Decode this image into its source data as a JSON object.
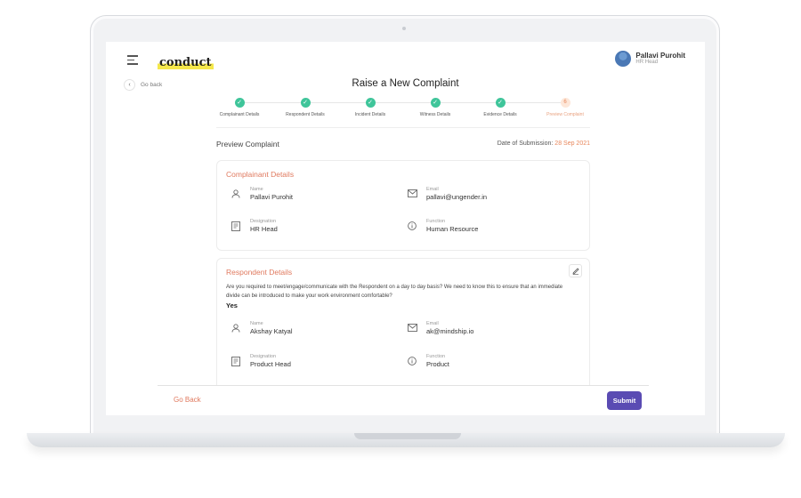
{
  "header": {
    "logo_text": "conduct",
    "user_name": "Pallavi Purohit",
    "user_role": "HR Head"
  },
  "nav": {
    "go_back_label": "Go back"
  },
  "page_title": "Raise a New Complaint",
  "stepper": {
    "steps": [
      {
        "label": "Complainant Details",
        "status": "done",
        "marker": "✓"
      },
      {
        "label": "Respondent Details",
        "status": "done",
        "marker": "✓"
      },
      {
        "label": "Incident Details",
        "status": "done",
        "marker": "✓"
      },
      {
        "label": "Witness Details",
        "status": "done",
        "marker": "✓"
      },
      {
        "label": "Evidence Details",
        "status": "done",
        "marker": "✓"
      },
      {
        "label": "Preview Complaint",
        "status": "current",
        "marker": "6"
      }
    ]
  },
  "preview": {
    "title": "Preview Complaint",
    "date_label": "Date of Submission:",
    "date_value": "28 Sep 2021"
  },
  "complainant": {
    "title": "Complainant Details",
    "name_label": "Name",
    "name_value": "Pallavi Purohit",
    "email_label": "Email",
    "email_value": "pallavi@ungender.in",
    "designation_label": "Designation",
    "designation_value": "HR Head",
    "function_label": "Function",
    "function_value": "Human Resource"
  },
  "respondent": {
    "title": "Respondent Details",
    "question": "Are you required to meet/engage/communicate with the Respondent on a day to day basis? We need to know this to ensure that an immediate divide can be introduced to make your work environment comfortable?",
    "answer": "Yes",
    "name_label": "Name",
    "name_value": "Akshay Katyal",
    "email_label": "Email",
    "email_value": "ak@mindship.io",
    "designation_label": "Designation",
    "designation_value": "Product Head",
    "function_label": "Function",
    "function_value": "Product"
  },
  "footer": {
    "go_back_label": "Go Back",
    "submit_label": "Submit"
  },
  "colors": {
    "accent": "#e07a5f",
    "done": "#3fc59a",
    "submit": "#5a4bb3",
    "highlight": "#f5e84a"
  }
}
